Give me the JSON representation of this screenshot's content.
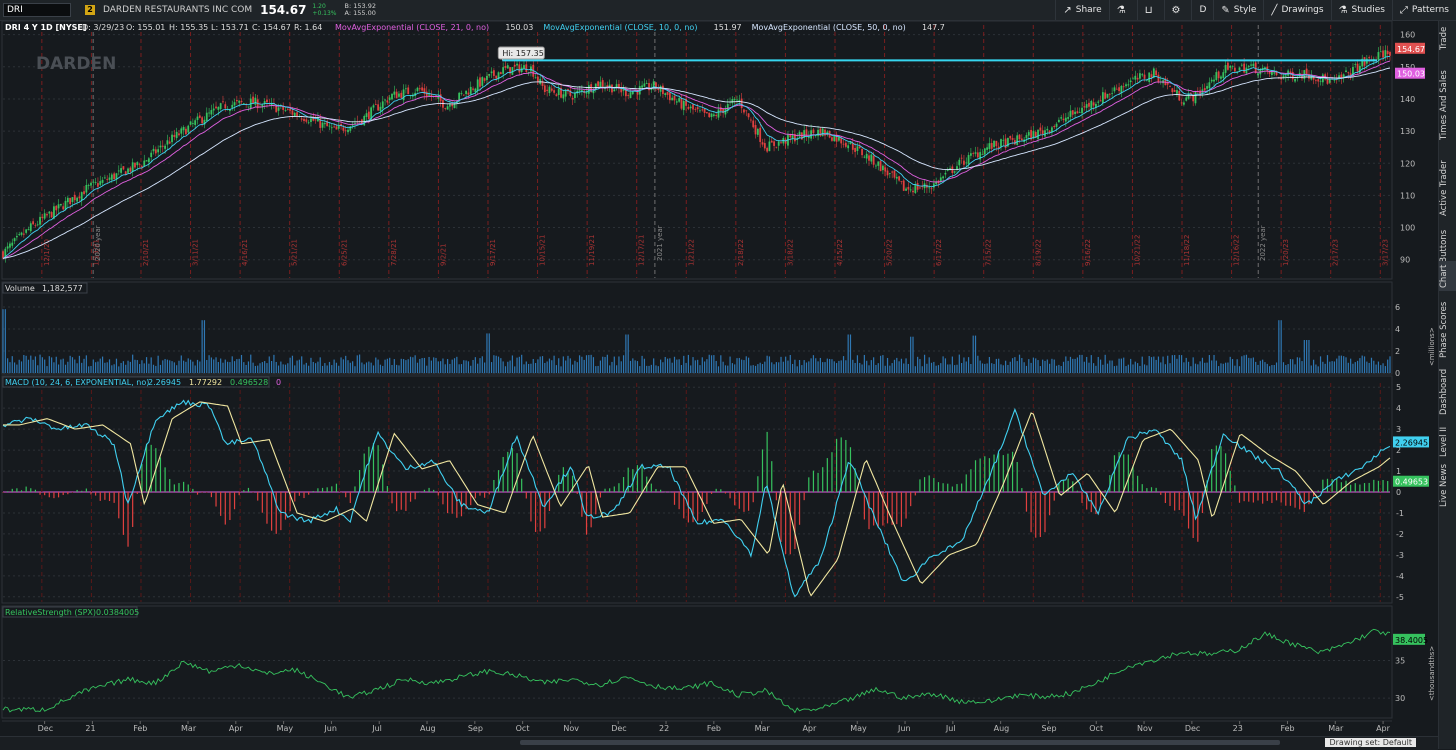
{
  "topbar": {
    "symbol": "DRI",
    "link_badge": "2",
    "company": "DARDEN RESTAURANTS INC COM",
    "last": "154.67",
    "change": "1.20",
    "change_pct": "+0.13%",
    "bid": "B: 153.92",
    "ask": "A: 155.00"
  },
  "toolbar": {
    "share": "Share",
    "interval": "D",
    "style": "Style",
    "drawings": "Drawings",
    "studies": "Studies",
    "patterns": "Patterns"
  },
  "sidebar": {
    "tabs": [
      "Trade",
      "Times And Sales",
      "Active Trader",
      "Big Buttons",
      "Chart",
      "Phase Scores",
      "Dashboard",
      "Level II",
      "Live News"
    ],
    "active": "Chart"
  },
  "bottombar": {
    "status": "Drawing set: Default"
  },
  "chart_data": [
    {
      "type": "candlestick",
      "panel": "price",
      "header": {
        "title": "DRI 4 Y 1D [NYSE]",
        "date": "D: 3/29/23",
        "open": "O: 155.01",
        "high": "H: 155.35",
        "low": "L: 153.71",
        "close": "C: 154.67",
        "range": "R: 1.64"
      },
      "watermark": "DARDEN",
      "studies": [
        {
          "label": "MovAvgExponential (CLOSE, 21, 0, no)",
          "value": "150.03",
          "color": "#e060e0"
        },
        {
          "label": "MovAvgExponential (CLOSE, 10, 0, no)",
          "value": "151.97",
          "color": "#40d0f0"
        },
        {
          "label": "MovAvgExponential (CLOSE, 50, 0, no)",
          "value": "147.7",
          "color": "#d6e6ff"
        }
      ],
      "high_bubble": "Hi: 157.35",
      "resistance_level": 152.0,
      "resistance_color": "#36d6f0",
      "ylim": [
        84,
        163
      ],
      "y_ticks": [
        "160",
        "150",
        "140",
        "130",
        "120",
        "110",
        "100",
        "90"
      ],
      "price_tags": [
        {
          "value": "154.67",
          "color": "#e05050"
        },
        {
          "value": "150.03",
          "color": "#e060e0"
        }
      ],
      "x_months": [
        "Dec",
        "21",
        "Feb",
        "Mar",
        "Apr",
        "May",
        "Jun",
        "Jul",
        "Aug",
        "Sep",
        "Oct",
        "Nov",
        "Dec",
        "22",
        "Feb",
        "Mar",
        "Apr",
        "May",
        "Jun",
        "Jul",
        "Aug",
        "Sep",
        "Oct",
        "Nov",
        "Dec",
        "23",
        "Feb",
        "Mar",
        "Apr"
      ],
      "vline_labels": [
        "12/1/20",
        "1/13/21",
        "2/10/21",
        "3/11/21",
        "4/16/21",
        "5/21/21",
        "6/25/21",
        "7/28/21",
        "9/2/21",
        "9/17/21",
        "10/15/21",
        "11/19/21",
        "12/17/21",
        "1/21/22",
        "2/18/22",
        "3/18/22",
        "4/15/22",
        "5/20/22",
        "6/17/22",
        "7/15/22",
        "8/19/22",
        "9/16/22",
        "10/21/22",
        "11/18/22",
        "12/16/22",
        "1/20/23",
        "2/17/23",
        "3/17/23"
      ],
      "year_labels": [
        "2020 year",
        "2021 year",
        "2022 year"
      ],
      "close_path": [
        [
          0,
          92
        ],
        [
          0.02,
          100
        ],
        [
          0.04,
          106
        ],
        [
          0.06,
          112
        ],
        [
          0.08,
          116
        ],
        [
          0.1,
          120
        ],
        [
          0.12,
          127
        ],
        [
          0.14,
          133
        ],
        [
          0.16,
          138
        ],
        [
          0.18,
          139
        ],
        [
          0.2,
          137
        ],
        [
          0.22,
          134
        ],
        [
          0.24,
          130
        ],
        [
          0.26,
          134
        ],
        [
          0.28,
          141
        ],
        [
          0.3,
          143
        ],
        [
          0.32,
          138
        ],
        [
          0.34,
          144
        ],
        [
          0.36,
          149
        ],
        [
          0.38,
          150
        ],
        [
          0.39,
          143
        ],
        [
          0.41,
          141
        ],
        [
          0.43,
          145
        ],
        [
          0.45,
          142
        ],
        [
          0.47,
          144
        ],
        [
          0.49,
          138
        ],
        [
          0.51,
          134
        ],
        [
          0.53,
          140
        ],
        [
          0.55,
          125
        ],
        [
          0.57,
          128
        ],
        [
          0.59,
          130
        ],
        [
          0.61,
          126
        ],
        [
          0.63,
          120
        ],
        [
          0.65,
          112
        ],
        [
          0.67,
          113
        ],
        [
          0.69,
          120
        ],
        [
          0.71,
          125
        ],
        [
          0.73,
          127
        ],
        [
          0.75,
          130
        ],
        [
          0.77,
          135
        ],
        [
          0.79,
          140
        ],
        [
          0.81,
          145
        ],
        [
          0.83,
          148
        ],
        [
          0.85,
          140
        ],
        [
          0.86,
          141
        ],
        [
          0.88,
          149
        ],
        [
          0.9,
          150
        ],
        [
          0.92,
          147
        ],
        [
          0.94,
          148
        ],
        [
          0.96,
          145
        ],
        [
          0.98,
          151
        ],
        [
          1.0,
          155
        ]
      ],
      "candle_count": 600
    },
    {
      "type": "bar",
      "panel": "volume",
      "header": {
        "title": "Volume",
        "value": "1,182,577"
      },
      "ylim": [
        0,
        7
      ],
      "y_ticks": [
        "6",
        "4",
        "2",
        "0"
      ],
      "y_axis_label": "<millions>",
      "bar_color": "#2f78b4",
      "bar_count": 600,
      "typical": 1.2,
      "spikes": [
        [
          0.0,
          5.8
        ],
        [
          0.145,
          6.2
        ],
        [
          0.145,
          4.8
        ],
        [
          0.35,
          3.6
        ],
        [
          0.45,
          3.5
        ],
        [
          0.61,
          3.5
        ],
        [
          0.655,
          3.3
        ],
        [
          0.7,
          3.4
        ],
        [
          0.92,
          4.8
        ],
        [
          0.94,
          3.0
        ]
      ]
    },
    {
      "type": "line",
      "panel": "macd",
      "header": {
        "title": "MACD (10, 24, 6, EXPONENTIAL, no)",
        "values": [
          "2.26945",
          "1.77292",
          "0.496528",
          "0"
        ],
        "colors": [
          "#40d0f0",
          "#f0e6a0",
          "#36c25e",
          "#e060e0"
        ]
      },
      "ylim": [
        -5.2,
        5.2
      ],
      "y_ticks": [
        "5",
        "4",
        "3",
        "2",
        "1",
        "0",
        "-1",
        "-2",
        "-3",
        "-4",
        "-5"
      ],
      "value_tags": [
        {
          "value": "2.26945",
          "color": "#40d0f0"
        },
        {
          "value": "0.49653",
          "color": "#36c25e"
        }
      ],
      "macd_path": [
        [
          0,
          3.2
        ],
        [
          0.02,
          3.5
        ],
        [
          0.04,
          3.0
        ],
        [
          0.06,
          3.2
        ],
        [
          0.08,
          2.3
        ],
        [
          0.09,
          -0.6
        ],
        [
          0.11,
          3.5
        ],
        [
          0.13,
          4.3
        ],
        [
          0.15,
          4.1
        ],
        [
          0.16,
          2.3
        ],
        [
          0.18,
          2.5
        ],
        [
          0.2,
          -1.0
        ],
        [
          0.22,
          -1.4
        ],
        [
          0.24,
          -0.8
        ],
        [
          0.25,
          -1.4
        ],
        [
          0.27,
          2.8
        ],
        [
          0.29,
          1.1
        ],
        [
          0.31,
          1.5
        ],
        [
          0.33,
          -0.6
        ],
        [
          0.35,
          -1.0
        ],
        [
          0.37,
          2.7
        ],
        [
          0.39,
          -0.7
        ],
        [
          0.41,
          1.3
        ],
        [
          0.42,
          -1.2
        ],
        [
          0.44,
          -1.0
        ],
        [
          0.46,
          1.2
        ],
        [
          0.48,
          1.2
        ],
        [
          0.5,
          -1.5
        ],
        [
          0.52,
          -1.3
        ],
        [
          0.54,
          -3.0
        ],
        [
          0.55,
          0.5
        ],
        [
          0.57,
          -5.0
        ],
        [
          0.59,
          -3.2
        ],
        [
          0.61,
          1.6
        ],
        [
          0.63,
          -1.5
        ],
        [
          0.65,
          -4.4
        ],
        [
          0.67,
          -3.0
        ],
        [
          0.69,
          -2.5
        ],
        [
          0.71,
          0.5
        ],
        [
          0.73,
          3.9
        ],
        [
          0.75,
          -0.2
        ],
        [
          0.77,
          0.9
        ],
        [
          0.79,
          -1.0
        ],
        [
          0.81,
          2.5
        ],
        [
          0.83,
          3.0
        ],
        [
          0.85,
          1.5
        ],
        [
          0.86,
          -1.3
        ],
        [
          0.88,
          2.8
        ],
        [
          0.9,
          1.8
        ],
        [
          0.92,
          1.0
        ],
        [
          0.94,
          -0.6
        ],
        [
          0.96,
          0.5
        ],
        [
          0.98,
          1.2
        ],
        [
          1.0,
          2.27
        ]
      ],
      "signal_lag": 0.012
    },
    {
      "type": "line",
      "panel": "relative_strength",
      "header": {
        "title": "RelativeStrength (SPX)",
        "value": "0.0384005"
      },
      "ylim": [
        27.5,
        40.5
      ],
      "y_ticks": [
        "35",
        "30"
      ],
      "y_axis_label": "<thousandths>",
      "value_tags": [
        {
          "value": "38.4005",
          "color": "#36c25e"
        }
      ],
      "rs_path": [
        [
          0,
          28.5
        ],
        [
          0.03,
          28.5
        ],
        [
          0.06,
          31
        ],
        [
          0.09,
          32.5
        ],
        [
          0.11,
          32
        ],
        [
          0.13,
          34.8
        ],
        [
          0.15,
          33.5
        ],
        [
          0.17,
          34.5
        ],
        [
          0.19,
          33.2
        ],
        [
          0.21,
          33.8
        ],
        [
          0.23,
          32
        ],
        [
          0.25,
          30
        ],
        [
          0.27,
          31.2
        ],
        [
          0.29,
          32.5
        ],
        [
          0.31,
          32
        ],
        [
          0.33,
          32.8
        ],
        [
          0.35,
          33.6
        ],
        [
          0.37,
          33
        ],
        [
          0.39,
          32
        ],
        [
          0.41,
          32.5
        ],
        [
          0.43,
          31.8
        ],
        [
          0.45,
          32.8
        ],
        [
          0.47,
          31.6
        ],
        [
          0.49,
          31.2
        ],
        [
          0.51,
          32
        ],
        [
          0.53,
          30.4
        ],
        [
          0.55,
          31
        ],
        [
          0.57,
          28.3
        ],
        [
          0.59,
          28.6
        ],
        [
          0.61,
          29.8
        ],
        [
          0.63,
          31.2
        ],
        [
          0.65,
          30
        ],
        [
          0.67,
          30.6
        ],
        [
          0.69,
          29.6
        ],
        [
          0.71,
          29.5
        ],
        [
          0.73,
          30.4
        ],
        [
          0.75,
          30.2
        ],
        [
          0.77,
          30.6
        ],
        [
          0.79,
          32.2
        ],
        [
          0.81,
          34.2
        ],
        [
          0.83,
          35.1
        ],
        [
          0.85,
          36.1
        ],
        [
          0.87,
          35.8
        ],
        [
          0.89,
          36.4
        ],
        [
          0.91,
          38.5
        ],
        [
          0.93,
          37.2
        ],
        [
          0.95,
          36.0
        ],
        [
          0.97,
          37.3
        ],
        [
          0.99,
          39.0
        ],
        [
          1.0,
          38.4
        ]
      ]
    }
  ]
}
